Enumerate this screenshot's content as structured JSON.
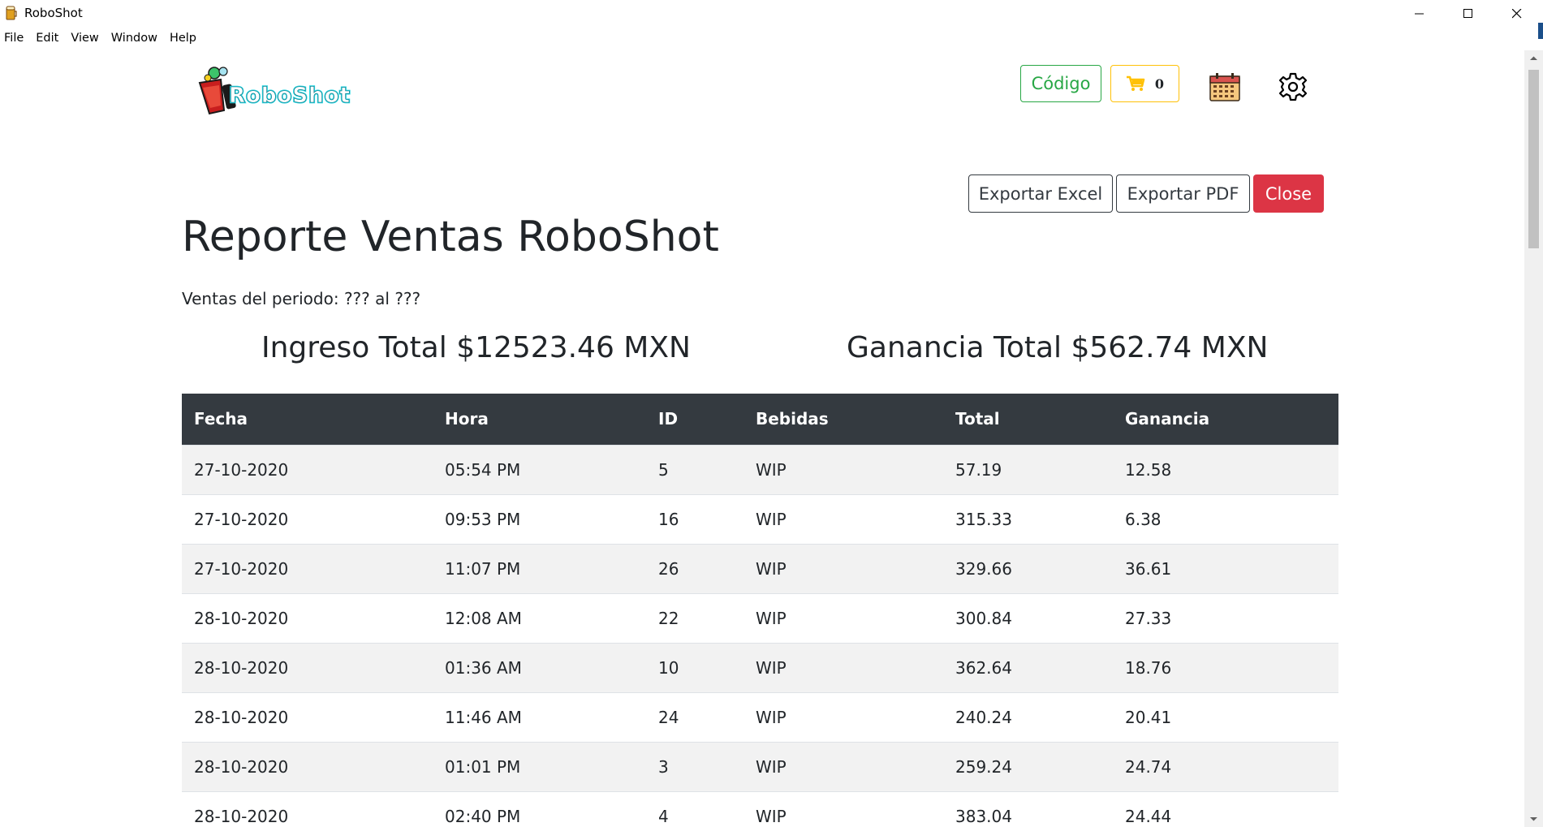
{
  "window": {
    "title": "RoboShot",
    "minimize_symbol": "—",
    "close_symbol": "✕"
  },
  "menu": [
    "File",
    "Edit",
    "View",
    "Window",
    "Help"
  ],
  "header": {
    "logo_text": "RoboShot",
    "codigo_label": "Código",
    "cart_count": "0",
    "icons": [
      "cart-icon",
      "calendar-icon",
      "gear-icon"
    ]
  },
  "actions": {
    "export_excel": "Exportar Excel",
    "export_pdf": "Exportar PDF",
    "close": "Close"
  },
  "report": {
    "title": "Reporte Ventas RoboShot",
    "period": "Ventas del periodo: ??? al ???",
    "total_income": "Ingreso Total $12523.46 MXN",
    "total_profit": "Ganancia Total $562.74 MXN"
  },
  "table": {
    "columns": [
      "Fecha",
      "Hora",
      "ID",
      "Bebidas",
      "Total",
      "Ganancia"
    ],
    "rows": [
      [
        "27-10-2020",
        "05:54 PM",
        "5",
        "WIP",
        "57.19",
        "12.58"
      ],
      [
        "27-10-2020",
        "09:53 PM",
        "16",
        "WIP",
        "315.33",
        "6.38"
      ],
      [
        "27-10-2020",
        "11:07 PM",
        "26",
        "WIP",
        "329.66",
        "36.61"
      ],
      [
        "28-10-2020",
        "12:08 AM",
        "22",
        "WIP",
        "300.84",
        "27.33"
      ],
      [
        "28-10-2020",
        "01:36 AM",
        "10",
        "WIP",
        "362.64",
        "18.76"
      ],
      [
        "28-10-2020",
        "11:46 AM",
        "24",
        "WIP",
        "240.24",
        "20.41"
      ],
      [
        "28-10-2020",
        "01:01 PM",
        "3",
        "WIP",
        "259.24",
        "24.74"
      ],
      [
        "28-10-2020",
        "02:40 PM",
        "4",
        "WIP",
        "383.04",
        "24.44"
      ]
    ]
  },
  "colors": {
    "table_header": "#343a40",
    "codigo_border": "#28a745",
    "cart_border": "#ffc107",
    "close_button": "#dc3545",
    "logo_cyan": "#1fd3e0"
  }
}
